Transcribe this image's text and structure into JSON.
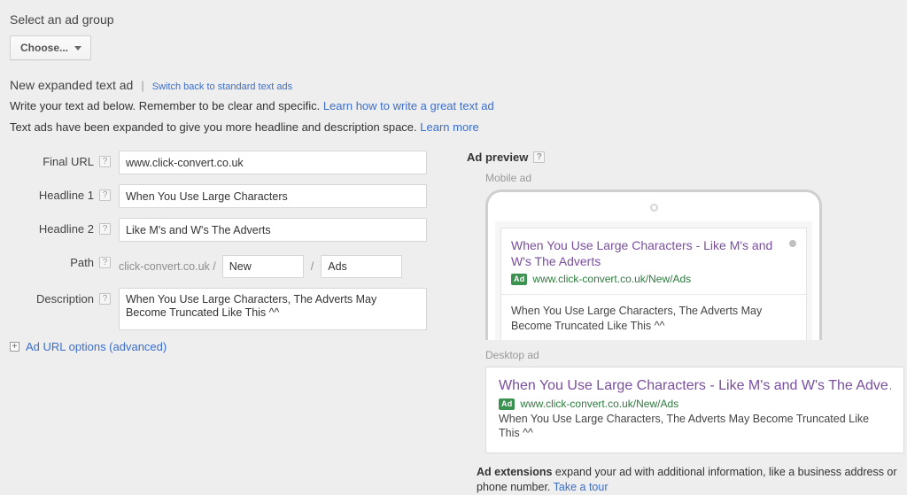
{
  "header": {
    "select_ad_group_title": "Select an ad group",
    "choose_button": "Choose...",
    "new_ad_title": "New expanded text ad",
    "pipe": "|",
    "switch_back_link": "Switch back to standard text ads",
    "write_line_text": "Write your text ad below. Remember to be clear and specific.",
    "write_line_link": "Learn how to write a great text ad",
    "expanded_line_text": "Text ads have been expanded to give you more headline and description space.",
    "expanded_line_link": "Learn more"
  },
  "form": {
    "help_glyph": "?",
    "final_url": {
      "label": "Final URL",
      "value": "www.click-convert.co.uk"
    },
    "headline1": {
      "label": "Headline 1",
      "value": "When You Use Large Characters"
    },
    "headline2": {
      "label": "Headline 2",
      "value": "Like M's and W's The Adverts"
    },
    "path": {
      "label": "Path",
      "domain": "click-convert.co.uk /",
      "separator": "/",
      "path1": "New",
      "path2": "Ads"
    },
    "description": {
      "label": "Description",
      "value": "When You Use Large Characters, The Adverts May Become Truncated Like This ^^"
    },
    "ad_url_options": {
      "expander": "+",
      "label": "Ad URL options (advanced)"
    }
  },
  "preview": {
    "title": "Ad preview",
    "help_glyph": "?",
    "mobile_label": "Mobile ad",
    "desktop_label": "Desktop ad",
    "mobile_ad": {
      "headline": "When You Use Large Characters - Like M's and W's The Adverts",
      "ad_badge": "Ad",
      "display_url": "www.click-convert.co.uk/New/Ads",
      "description": "When You Use Large Characters, The Adverts May Become Truncated Like This ^^"
    },
    "desktop_ad": {
      "headline": "When You Use Large Characters - Like M's and W's The Adve…",
      "ad_badge": "Ad",
      "display_url": "www.click-convert.co.uk/New/Ads",
      "description": "When You Use Large Characters, The Adverts May Become Truncated Like This ^^"
    },
    "extensions": {
      "bold": "Ad extensions",
      "text": " expand your ad with additional information, like a business address or phone number. ",
      "link": "Take a tour"
    }
  },
  "colors": {
    "page_background": "#eeeeee",
    "link_blue": "#3b6ecc",
    "headline_purple": "#7a4f9e",
    "url_green": "#2f7a3f",
    "ad_badge_green": "#3a9150"
  }
}
